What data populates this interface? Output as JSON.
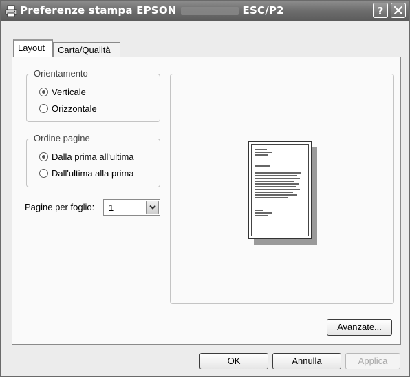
{
  "window": {
    "title_prefix": "Preferenze stampa EPSON",
    "title_suffix": "ESC/P2",
    "help_label": "?",
    "icon": "printer-icon",
    "close_icon": "close-icon"
  },
  "tabs": [
    {
      "label": "Layout",
      "active": true
    },
    {
      "label": "Carta/Qualità",
      "active": false
    }
  ],
  "orientation": {
    "title": "Orientamento",
    "options": [
      {
        "label": "Verticale",
        "checked": true
      },
      {
        "label": "Orizzontale",
        "checked": false
      }
    ]
  },
  "page_order": {
    "title": "Ordine pagine",
    "options": [
      {
        "label": "Dalla prima all'ultima",
        "checked": true
      },
      {
        "label": "Dall'ultima alla prima",
        "checked": false
      }
    ]
  },
  "pages_per_sheet": {
    "label": "Pagine per foglio:",
    "value": "1",
    "dropdown_icon": "chevron-down-icon"
  },
  "buttons": {
    "advanced": "Avanzate...",
    "ok": "OK",
    "cancel": "Annulla",
    "apply": "Applica"
  }
}
